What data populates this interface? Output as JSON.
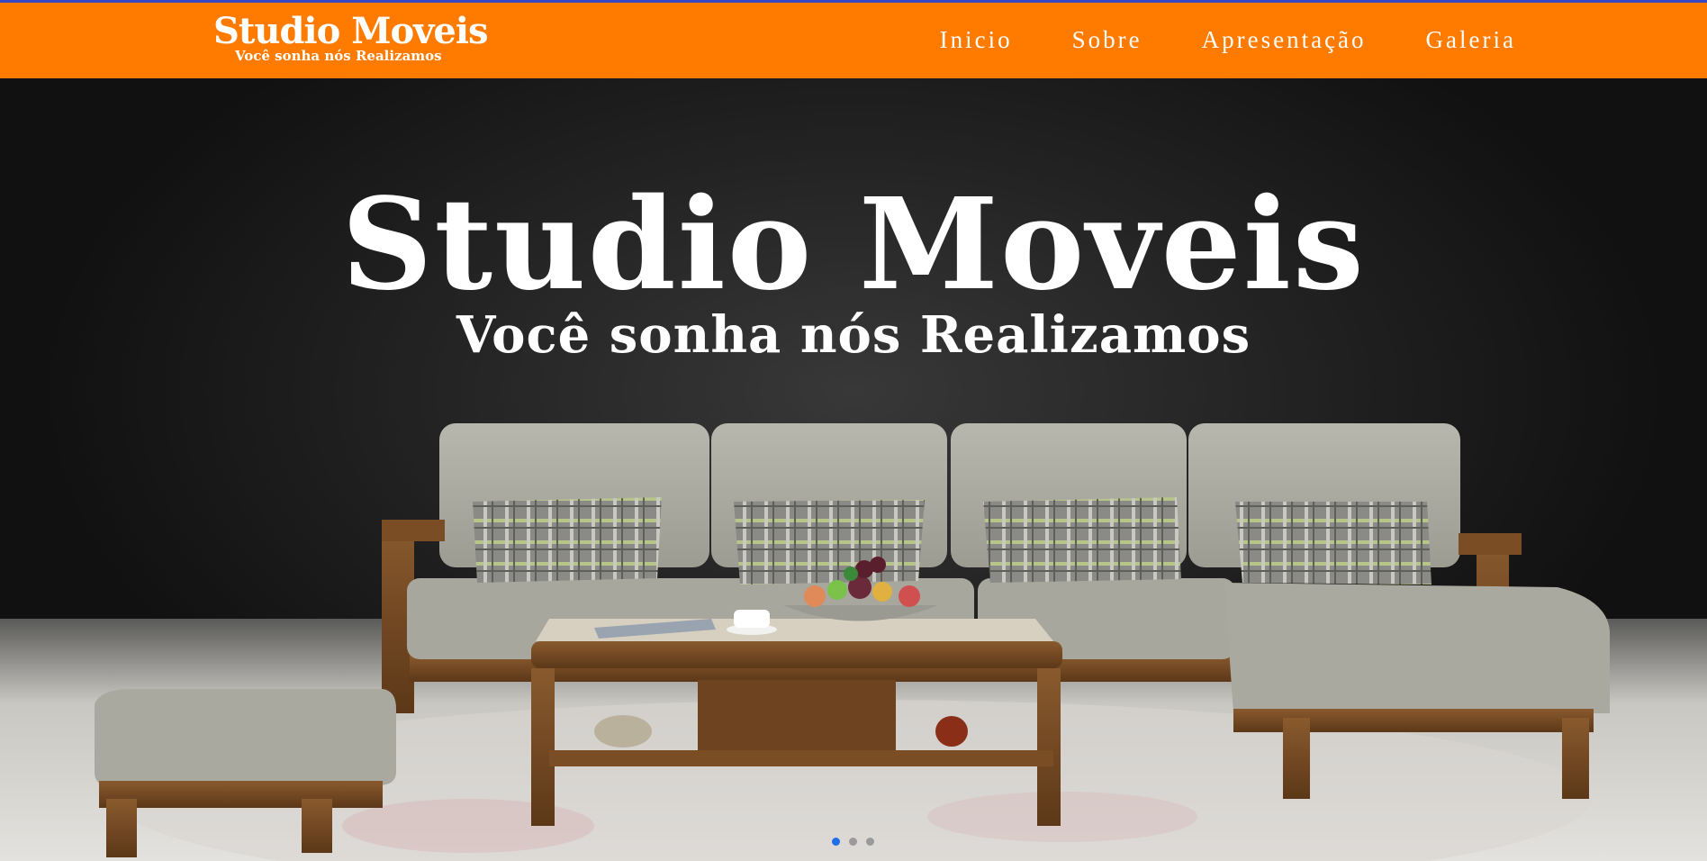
{
  "brand": {
    "title": "Studio Moveis",
    "subtitle": "Você sonha nós Realizamos"
  },
  "nav": {
    "items": [
      "Inicio",
      "Sobre",
      "Apresentação",
      "Galeria"
    ]
  },
  "hero": {
    "title": "Studio Moveis",
    "subtitle": "Você sonha nós Realizamos",
    "image": "sofa-living-room-photo"
  },
  "carousel": {
    "slide_count": 3,
    "active_index": 0
  },
  "colors": {
    "accent": "#ff7b00",
    "top_line": "#3b46c4",
    "active_dot": "#1e6fe8"
  }
}
